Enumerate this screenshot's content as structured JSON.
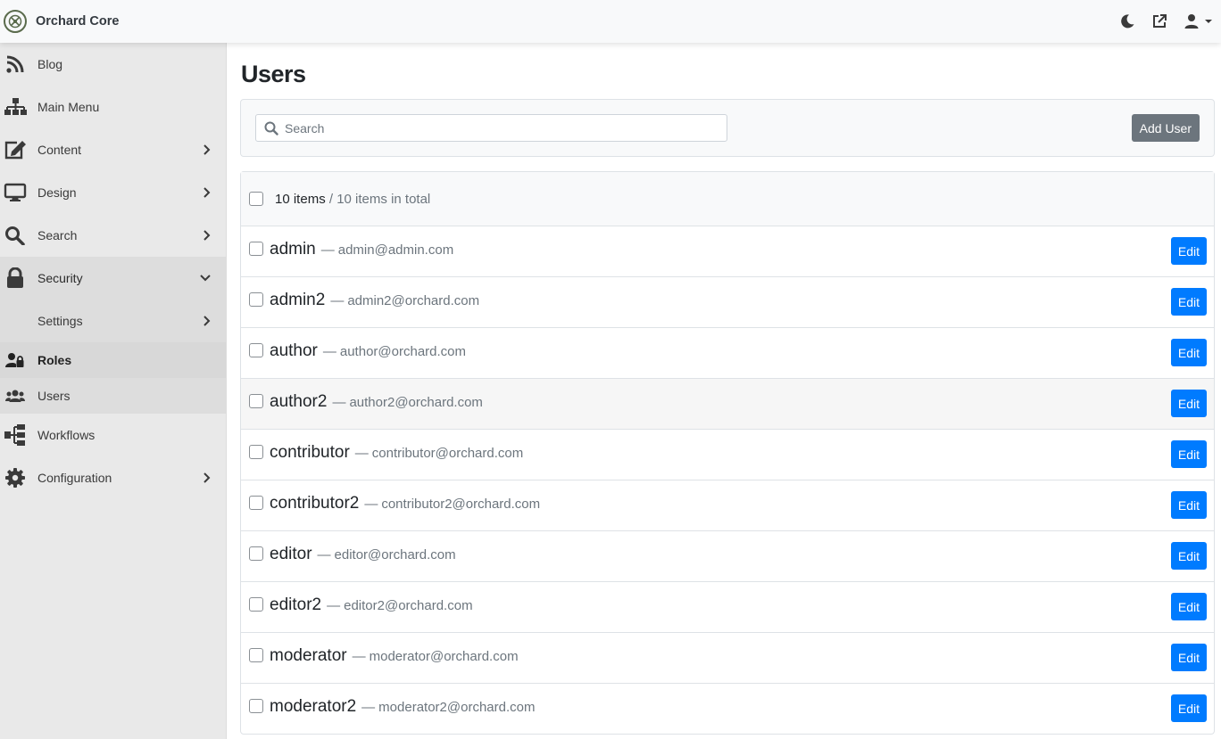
{
  "header": {
    "brand": "Orchard Core"
  },
  "sidebar": {
    "items": [
      {
        "label": "Blog",
        "icon": "rss-icon"
      },
      {
        "label": "Main Menu",
        "icon": "sitemap-icon"
      },
      {
        "label": "Content",
        "icon": "edit-icon"
      },
      {
        "label": "Design",
        "icon": "desktop-icon"
      },
      {
        "label": "Search",
        "icon": "search-icon"
      },
      {
        "label": "Security",
        "icon": "lock-icon"
      },
      {
        "label": "Workflows",
        "icon": "workflow-icon"
      },
      {
        "label": "Configuration",
        "icon": "cog-icon"
      }
    ],
    "security_sub": {
      "settings": "Settings",
      "roles": "Roles",
      "users": "Users"
    }
  },
  "main": {
    "title": "Users",
    "search_placeholder": "Search",
    "add_user": "Add User",
    "summary_count": "10 items",
    "summary_total": "/ 10 items in total",
    "edit_label": "Edit",
    "dash": "—",
    "users": [
      {
        "name": "admin",
        "email": "admin@admin.com"
      },
      {
        "name": "admin2",
        "email": "admin2@orchard.com"
      },
      {
        "name": "author",
        "email": "author@orchard.com"
      },
      {
        "name": "author2",
        "email": "author2@orchard.com"
      },
      {
        "name": "contributor",
        "email": "contributor@orchard.com"
      },
      {
        "name": "contributor2",
        "email": "contributor2@orchard.com"
      },
      {
        "name": "editor",
        "email": "editor@orchard.com"
      },
      {
        "name": "editor2",
        "email": "editor2@orchard.com"
      },
      {
        "name": "moderator",
        "email": "moderator@orchard.com"
      },
      {
        "name": "moderator2",
        "email": "moderator2@orchard.com"
      }
    ]
  },
  "colors": {
    "primary": "#007bff",
    "secondary": "#6c757d",
    "sidebar_bg": "#e9e9e9"
  }
}
